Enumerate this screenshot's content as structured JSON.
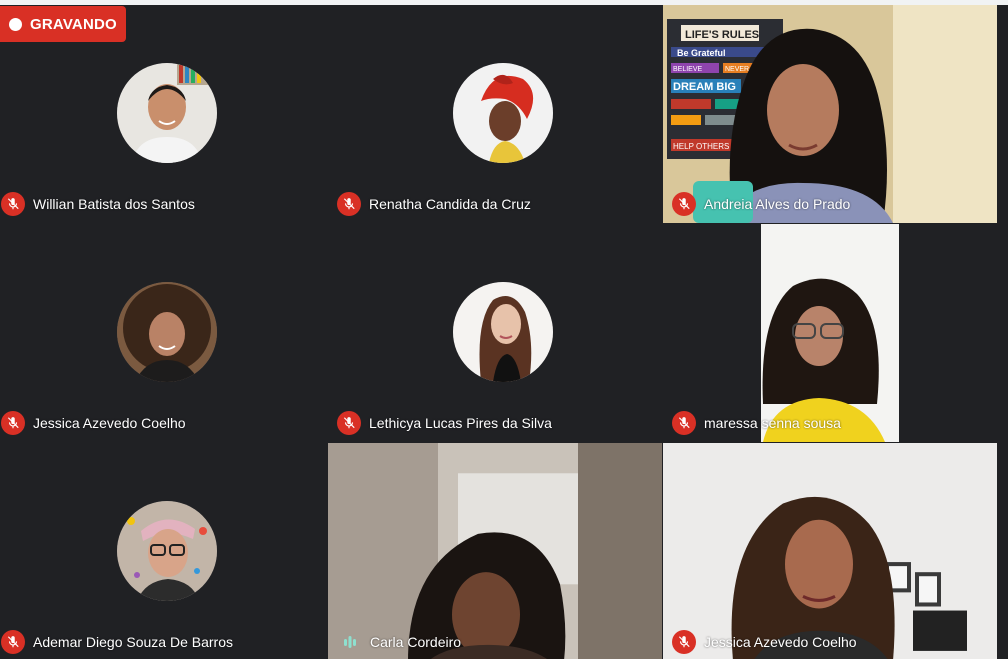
{
  "recording": {
    "label": "GRAVANDO"
  },
  "participants": [
    {
      "name": "Willian Batista dos Santos",
      "mic": "muted"
    },
    {
      "name": "Renatha Candida da Cruz",
      "mic": "muted"
    },
    {
      "name": "Andreia Alves do Prado",
      "mic": "muted",
      "poster_text": [
        "LIFE'S RULES",
        "Be Grateful",
        "BELIEVE",
        "NEVER",
        "DREAM BIG",
        "HELP OTHERS"
      ]
    },
    {
      "name": "Jessica Azevedo Coelho",
      "mic": "muted"
    },
    {
      "name": "Lethicya Lucas Pires da Silva",
      "mic": "muted"
    },
    {
      "name": "maressa senna sousa",
      "mic": "muted"
    },
    {
      "name": "Ademar Diego Souza De Barros",
      "mic": "muted"
    },
    {
      "name": "Carla Cordeiro",
      "mic": "speaking"
    },
    {
      "name": "Jessica Azevedo Coelho",
      "mic": "muted"
    }
  ],
  "colors": {
    "background": "#202124",
    "muted_badge": "#d93025",
    "speaking_indicator": "#8ee0cf",
    "recording_badge": "#d93025"
  }
}
